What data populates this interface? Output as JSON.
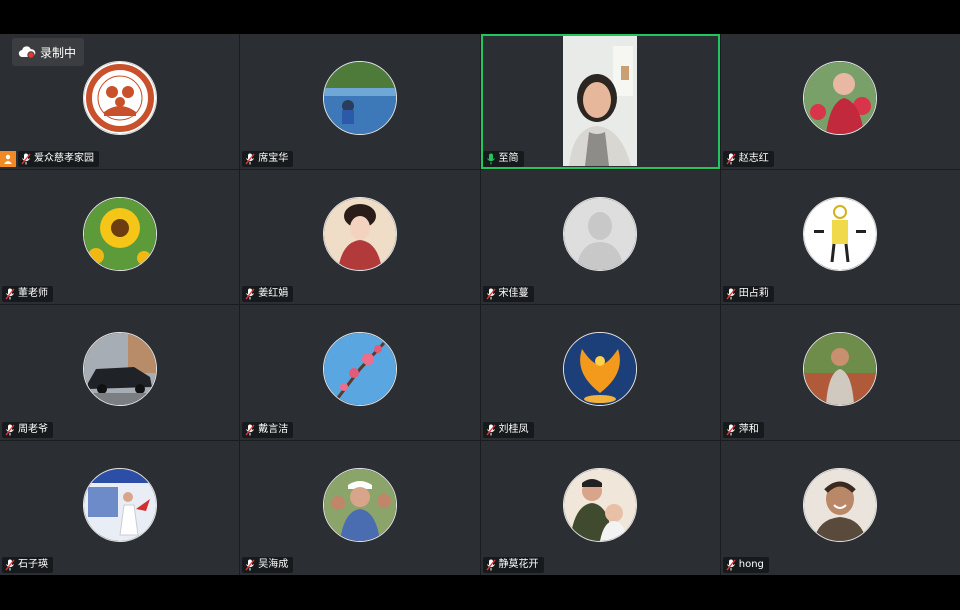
{
  "recording": {
    "label": "录制中",
    "icon": "cloud-record-icon",
    "dot_color": "#e53935"
  },
  "colors": {
    "active_border": "#22c55e",
    "host_badge": "#f08a24",
    "tile_bg": "#2b2e33",
    "mic_active": "#22c55e"
  },
  "participants": [
    {
      "name": "爱众慈孝家园",
      "avatar": "logo-avatar",
      "host": true,
      "muted": true
    },
    {
      "name": "席宝华",
      "avatar": "lake-fishing-photo",
      "muted": true
    },
    {
      "name": "至简",
      "avatar": "live-video",
      "speaking": true,
      "muted": false
    },
    {
      "name": "赵志红",
      "avatar": "flowers-portrait-photo",
      "muted": true
    },
    {
      "name": "董老师",
      "avatar": "sunflower-photo",
      "muted": true
    },
    {
      "name": "姜红娟",
      "avatar": "classical-beauty-painting",
      "muted": true
    },
    {
      "name": "宋佳蔓",
      "avatar": "default-avatar",
      "muted": true
    },
    {
      "name": "田占莉",
      "avatar": "calligraphy-figure-image",
      "muted": true
    },
    {
      "name": "周老爷",
      "avatar": "car-photo",
      "muted": true
    },
    {
      "name": "戴言洁",
      "avatar": "plum-blossom-photo",
      "muted": true
    },
    {
      "name": "刘桂凤",
      "avatar": "phoenix-image",
      "muted": true
    },
    {
      "name": "萍和",
      "avatar": "woman-outdoor-photo",
      "muted": true
    },
    {
      "name": "石子瑛",
      "avatar": "taichi-stage-photo",
      "muted": true
    },
    {
      "name": "吴海成",
      "avatar": "group-man-cap-photo",
      "muted": true
    },
    {
      "name": "静莫花开",
      "avatar": "father-child-photo",
      "muted": true
    },
    {
      "name": "hong",
      "avatar": "smiling-woman-photo",
      "muted": true
    }
  ]
}
